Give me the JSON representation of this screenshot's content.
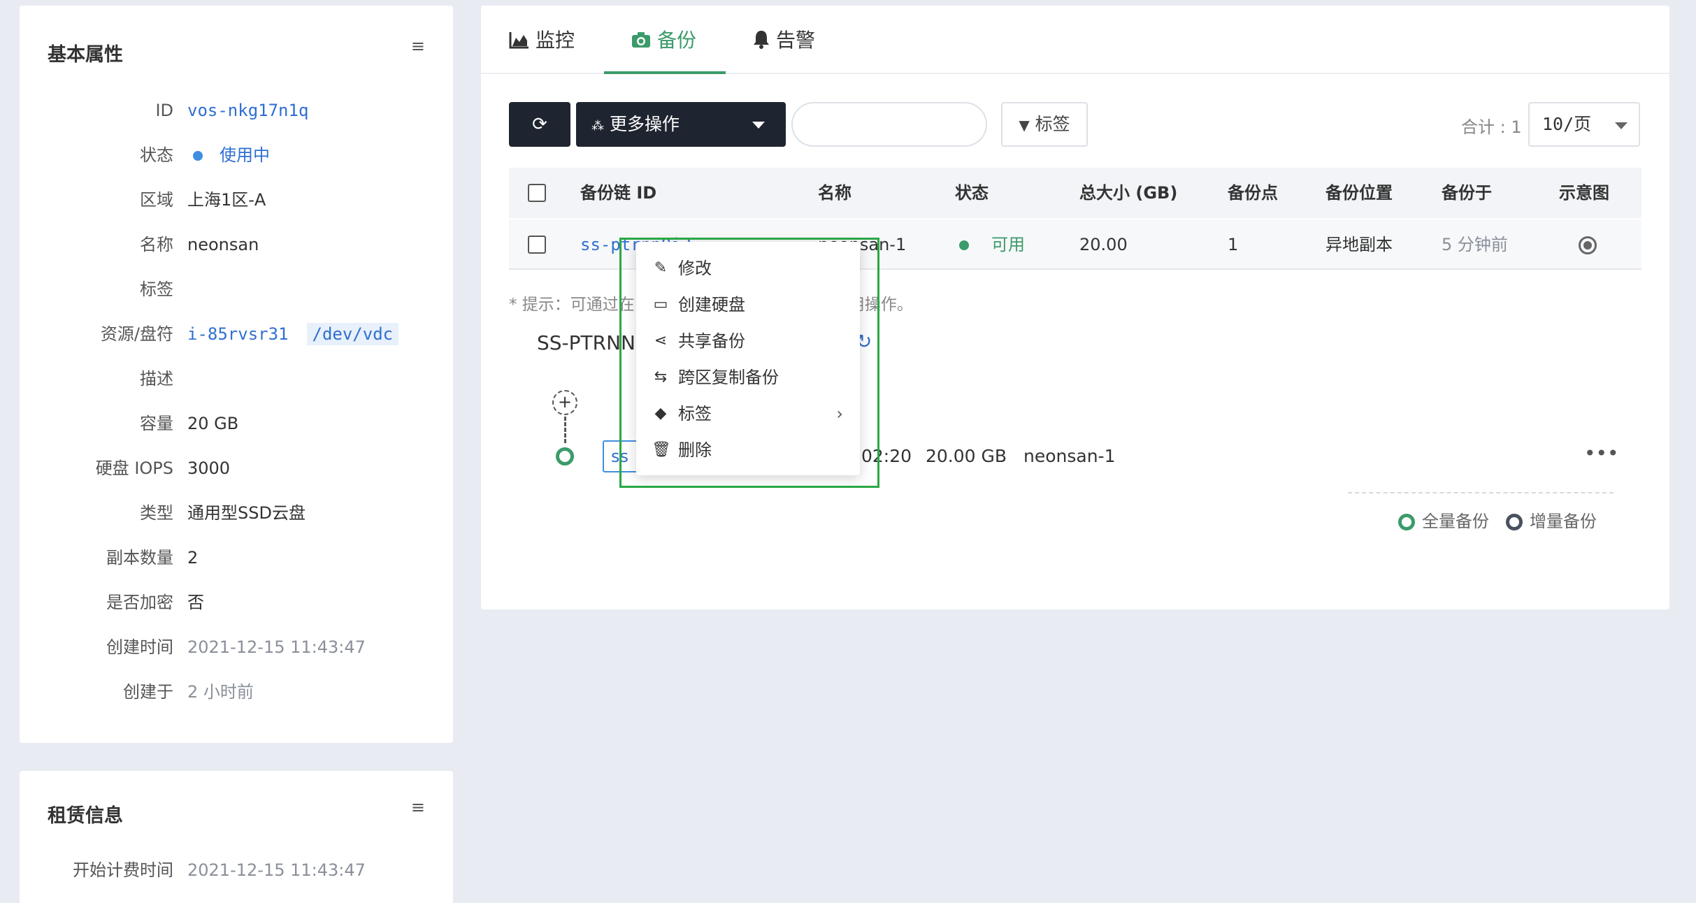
{
  "attributes_panel": {
    "title": "基本属性",
    "menu_icon": "hamburger-icon",
    "rows": [
      {
        "label": "ID",
        "value": "vos-nkg17n1q"
      },
      {
        "label": "状态",
        "value": "使用中"
      },
      {
        "label": "区域",
        "value": "上海1区-A"
      },
      {
        "label": "名称",
        "value": "neonsan"
      },
      {
        "label": "标签",
        "value": ""
      },
      {
        "label": "资源/盘符",
        "value": "i-85rvsr31",
        "value2": "/dev/vdc"
      },
      {
        "label": "描述",
        "value": ""
      },
      {
        "label": "容量",
        "value": "20 GB"
      },
      {
        "label": "硬盘 IOPS",
        "value": "3000"
      },
      {
        "label": "类型",
        "value": "通用型SSD云盘"
      },
      {
        "label": "副本数量",
        "value": "2"
      },
      {
        "label": "是否加密",
        "value": "否"
      },
      {
        "label": "创建时间",
        "value": "2021-12-15 11:43:47"
      },
      {
        "label": "创建于",
        "value": "2 小时前"
      }
    ]
  },
  "lease_panel": {
    "title": "租赁信息",
    "rows": [
      {
        "label": "开始计费时间",
        "value": "2021-12-15 11:43:47"
      }
    ]
  },
  "tabs": [
    {
      "label": "监控",
      "icon": "area-chart-icon"
    },
    {
      "label": "备份",
      "icon": "camera-icon"
    },
    {
      "label": "告警",
      "icon": "bell-icon"
    }
  ],
  "toolbar": {
    "refresh_icon": "refresh-icon",
    "more_actions_label": "更多操作",
    "search_placeholder": "",
    "tag_filter_label": "标签",
    "total_label": "合计 : 1",
    "page_size": "10/页"
  },
  "table": {
    "columns": [
      "备份链 ID",
      "名称",
      "状态",
      "总大小 (GB)",
      "备份点",
      "备份位置",
      "备份于",
      "示意图"
    ],
    "rows": [
      {
        "id": "ss-ptrnn0i3",
        "name": "neonsan-1",
        "status": "可用",
        "size": "20.00",
        "points": "1",
        "location": "异地副本",
        "backed_up": "5 分钟前"
      }
    ]
  },
  "hint": "* 提示：可通过在",
  "hint_tail": "行常用操作。",
  "chain": {
    "title": "SS-PTRNN",
    "node_chip": "ss",
    "node_time": "02:20",
    "node_size": "20.00 GB",
    "node_name": "neonsan-1",
    "legend_full": "全量备份",
    "legend_incremental": "增量备份"
  },
  "context_menu": [
    {
      "label": "修改",
      "icon": "pencil-icon"
    },
    {
      "label": "创建硬盘",
      "icon": "disk-icon"
    },
    {
      "label": "共享备份",
      "icon": "share-icon"
    },
    {
      "label": "跨区复制备份",
      "icon": "transfer-icon"
    },
    {
      "label": "标签",
      "icon": "tag-icon",
      "has_submenu": true
    },
    {
      "label": "删除",
      "icon": "trash-icon"
    }
  ],
  "colors": {
    "accent_green": "#3b9b6a",
    "link_blue": "#2f6fd0",
    "dark_button": "#1f2530",
    "highlight_box": "#2aa745"
  }
}
